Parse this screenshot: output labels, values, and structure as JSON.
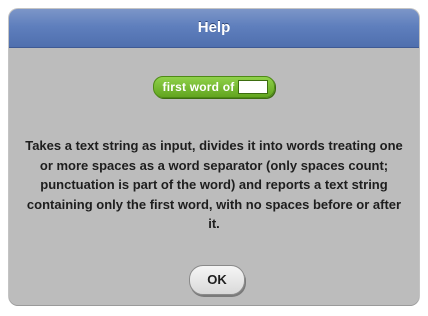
{
  "dialog": {
    "title": "Help",
    "block": {
      "label": "first word of",
      "color": "#62a51f"
    },
    "description": "Takes a text string as input, divides it into words treating one or more spaces as a word separator (only spaces count; punctuation is part of the word) and reports a text string containing only the first word, with no spaces before or after it.",
    "ok_label": "OK"
  },
  "colors": {
    "titlebar": "#5f7fbd",
    "dialog_body": "#bcbcbc",
    "text": "#1e1e1e"
  }
}
